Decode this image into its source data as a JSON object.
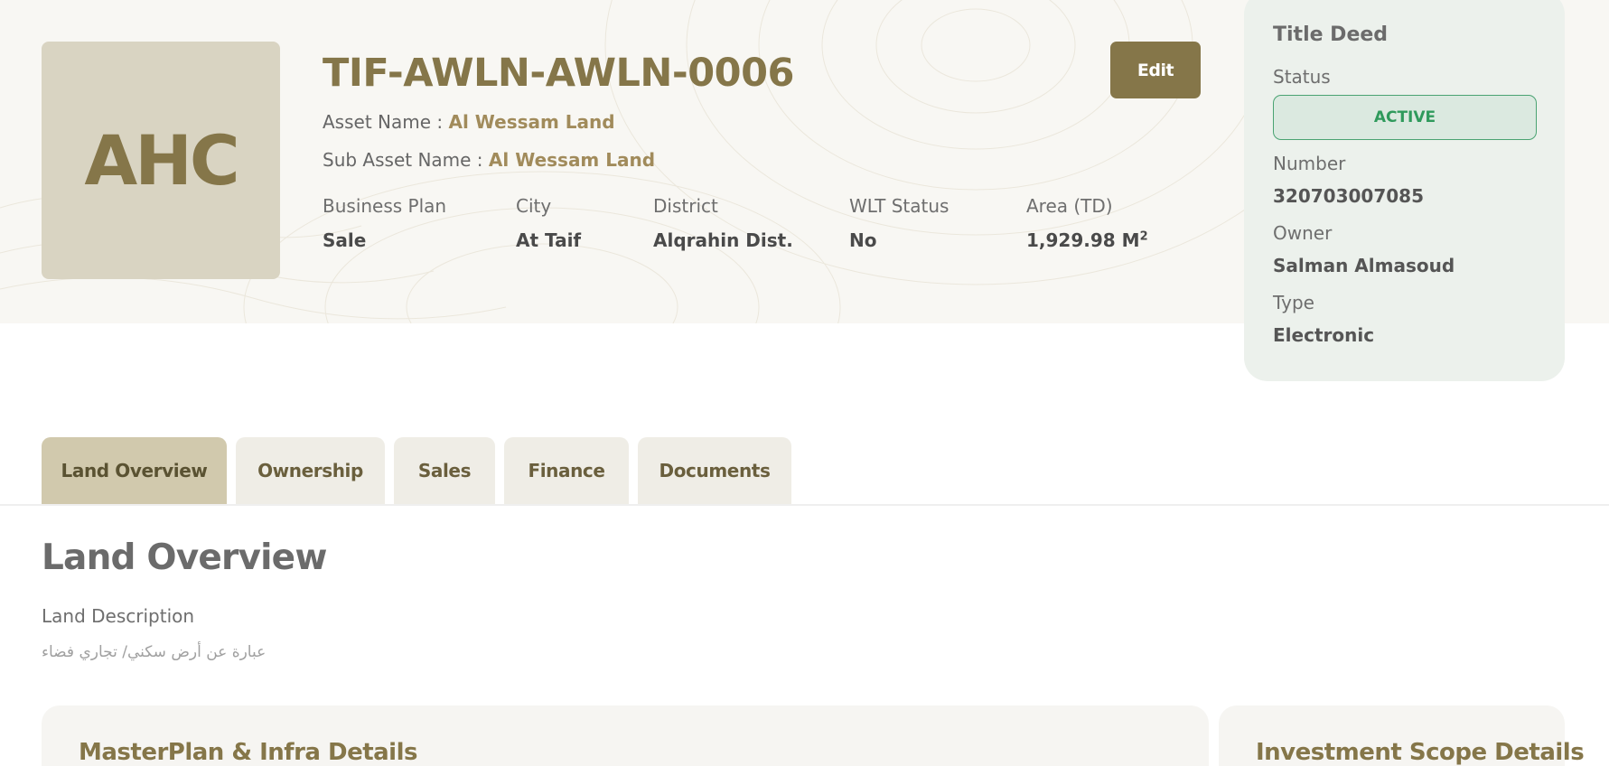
{
  "header": {
    "logo_text": "AHC",
    "asset_code": "TIF-AWLN-AWLN-0006",
    "asset_name_label": "Asset Name :",
    "asset_name_value": "Al Wessam Land",
    "sub_asset_name_label": "Sub Asset Name :",
    "sub_asset_name_value": "Al Wessam Land",
    "edit_label": "Edit",
    "facts": [
      {
        "label": "Business Plan",
        "value": "Sale"
      },
      {
        "label": "City",
        "value": "At Taif"
      },
      {
        "label": "District",
        "value": "Alqrahin Dist."
      },
      {
        "label": "WLT Status",
        "value": "No"
      },
      {
        "label": "Area (TD)",
        "value": "1,929.98 M",
        "unit_sup": "2"
      }
    ]
  },
  "title_deed": {
    "title": "Title Deed",
    "status_label": "Status",
    "status_value": "ACTIVE",
    "number_label": "Number",
    "number_value": "320703007085",
    "owner_label": "Owner",
    "owner_value": "Salman Almasoud",
    "type_label": "Type",
    "type_value": "Electronic"
  },
  "tabs": [
    {
      "label": "Land Overview",
      "active": true
    },
    {
      "label": "Ownership",
      "active": false
    },
    {
      "label": "Sales",
      "active": false
    },
    {
      "label": "Finance",
      "active": false
    },
    {
      "label": "Documents",
      "active": false
    }
  ],
  "overview": {
    "title": "Land Overview",
    "description_label": "Land Description",
    "description_text": "عبارة عن أرض سكني/ تجاري فضاء"
  },
  "cards": {
    "masterplan_title": "MasterPlan & Infra Details",
    "investment_title": "Investment Scope Details"
  },
  "colors": {
    "brand": "#857649",
    "accent_text": "#a18b5b",
    "status_green": "#2f9a5c",
    "deed_bg": "#ecf1ec",
    "tab_active": "#d1c9ad",
    "tab_inactive": "#efede6"
  }
}
